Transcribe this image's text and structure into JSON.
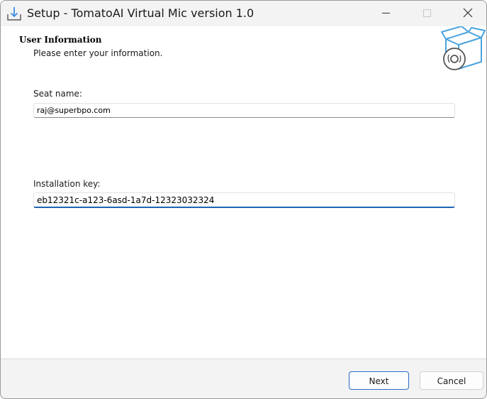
{
  "window": {
    "title": "Setup - TomatoAI Virtual Mic version 1.0",
    "controls": {
      "minimize": "minimize-icon",
      "maximize": "maximize-icon",
      "close": "close-icon"
    }
  },
  "page": {
    "heading": "User Information",
    "subheading": "Please enter your information."
  },
  "form": {
    "seat_label": "Seat name:",
    "seat_value": "raj@superbpo.com",
    "key_label": "Installation key:",
    "key_value": "eb12321c-a123-6asd-1a7d-12323032324"
  },
  "footer": {
    "next_label": "Next",
    "cancel_label": "Cancel"
  },
  "colors": {
    "accent": "#1f64b4",
    "icon_blue": "#4aa3df"
  }
}
